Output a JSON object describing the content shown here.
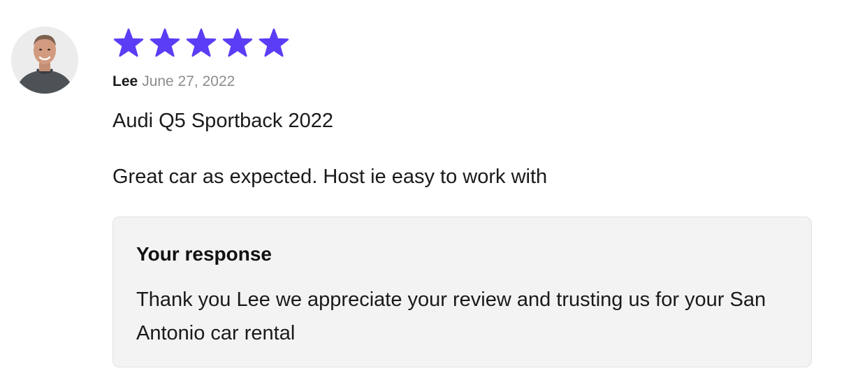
{
  "review": {
    "rating": 5,
    "rating_max": 5,
    "star_color": "#5b3df5",
    "reviewer_name": "Lee",
    "date": "June 27, 2022",
    "vehicle": "Audi Q5 Sportback 2022",
    "text": "Great car as expected. Host ie easy to work with"
  },
  "response": {
    "heading": "Your response",
    "text": "Thank you Lee we appreciate your review and trusting us for your San Antonio car rental"
  },
  "icons": {
    "avatar": "user-avatar-photo",
    "star": "star-icon"
  },
  "colors": {
    "text": "#1a1a1a",
    "muted": "#8d8d8d",
    "response_bg": "#f3f3f3",
    "response_border": "#e2e2e2"
  }
}
